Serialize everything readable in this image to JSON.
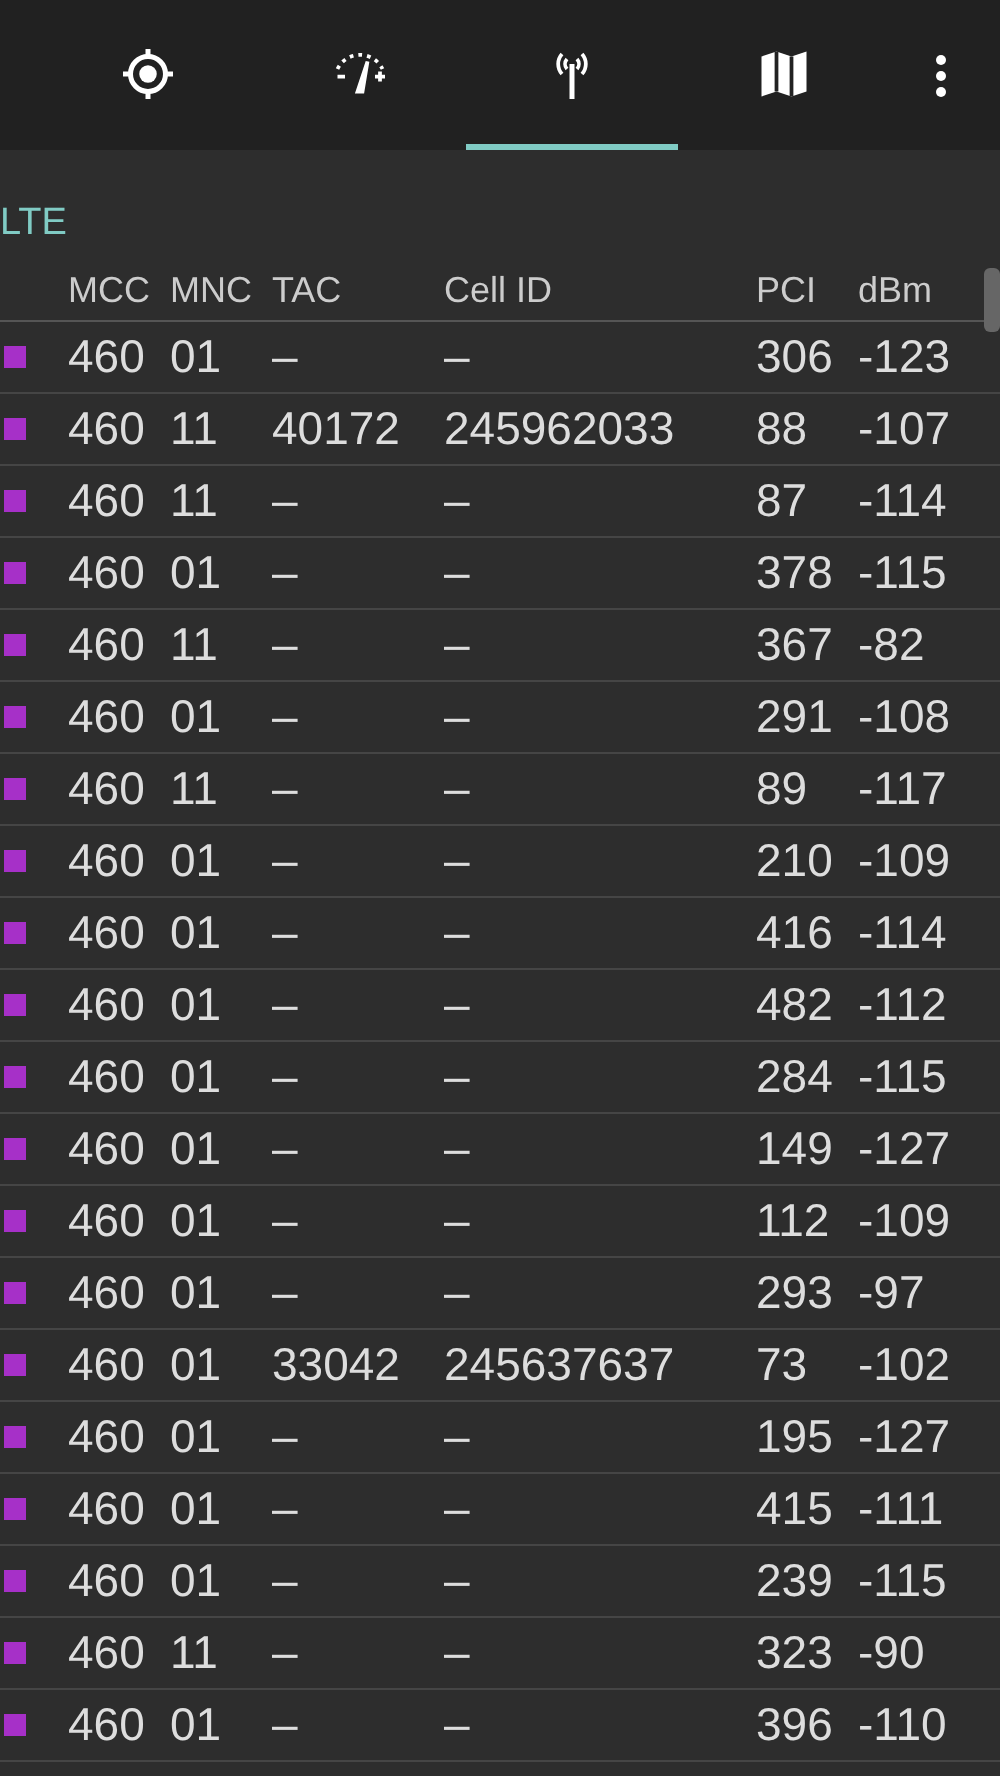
{
  "tabs": [
    {
      "kind": "location",
      "selected": false
    },
    {
      "kind": "speedometer",
      "selected": false
    },
    {
      "kind": "antenna",
      "selected": true
    },
    {
      "kind": "map",
      "selected": false
    }
  ],
  "section": {
    "title": "LTE"
  },
  "table": {
    "columns": [
      "MCC",
      "MNC",
      "TAC",
      "Cell ID",
      "PCI",
      "dBm"
    ],
    "rows": [
      [
        "460",
        "01",
        "–",
        "–",
        "306",
        "-123"
      ],
      [
        "460",
        "11",
        "40172",
        "245962033",
        "88",
        "-107"
      ],
      [
        "460",
        "11",
        "–",
        "–",
        "87",
        "-114"
      ],
      [
        "460",
        "01",
        "–",
        "–",
        "378",
        "-115"
      ],
      [
        "460",
        "11",
        "–",
        "–",
        "367",
        "-82"
      ],
      [
        "460",
        "01",
        "–",
        "–",
        "291",
        "-108"
      ],
      [
        "460",
        "11",
        "–",
        "–",
        "89",
        "-117"
      ],
      [
        "460",
        "01",
        "–",
        "–",
        "210",
        "-109"
      ],
      [
        "460",
        "01",
        "–",
        "–",
        "416",
        "-114"
      ],
      [
        "460",
        "01",
        "–",
        "–",
        "482",
        "-112"
      ],
      [
        "460",
        "01",
        "–",
        "–",
        "284",
        "-115"
      ],
      [
        "460",
        "01",
        "–",
        "–",
        "149",
        "-127"
      ],
      [
        "460",
        "01",
        "–",
        "–",
        "112",
        "-109"
      ],
      [
        "460",
        "01",
        "–",
        "–",
        "293",
        "-97"
      ],
      [
        "460",
        "01",
        "33042",
        "245637637",
        "73",
        "-102"
      ],
      [
        "460",
        "01",
        "–",
        "–",
        "195",
        "-127"
      ],
      [
        "460",
        "01",
        "–",
        "–",
        "415",
        "-111"
      ],
      [
        "460",
        "01",
        "–",
        "–",
        "239",
        "-115"
      ],
      [
        "460",
        "11",
        "–",
        "–",
        "323",
        "-90"
      ],
      [
        "460",
        "01",
        "–",
        "–",
        "396",
        "-110"
      ]
    ]
  }
}
